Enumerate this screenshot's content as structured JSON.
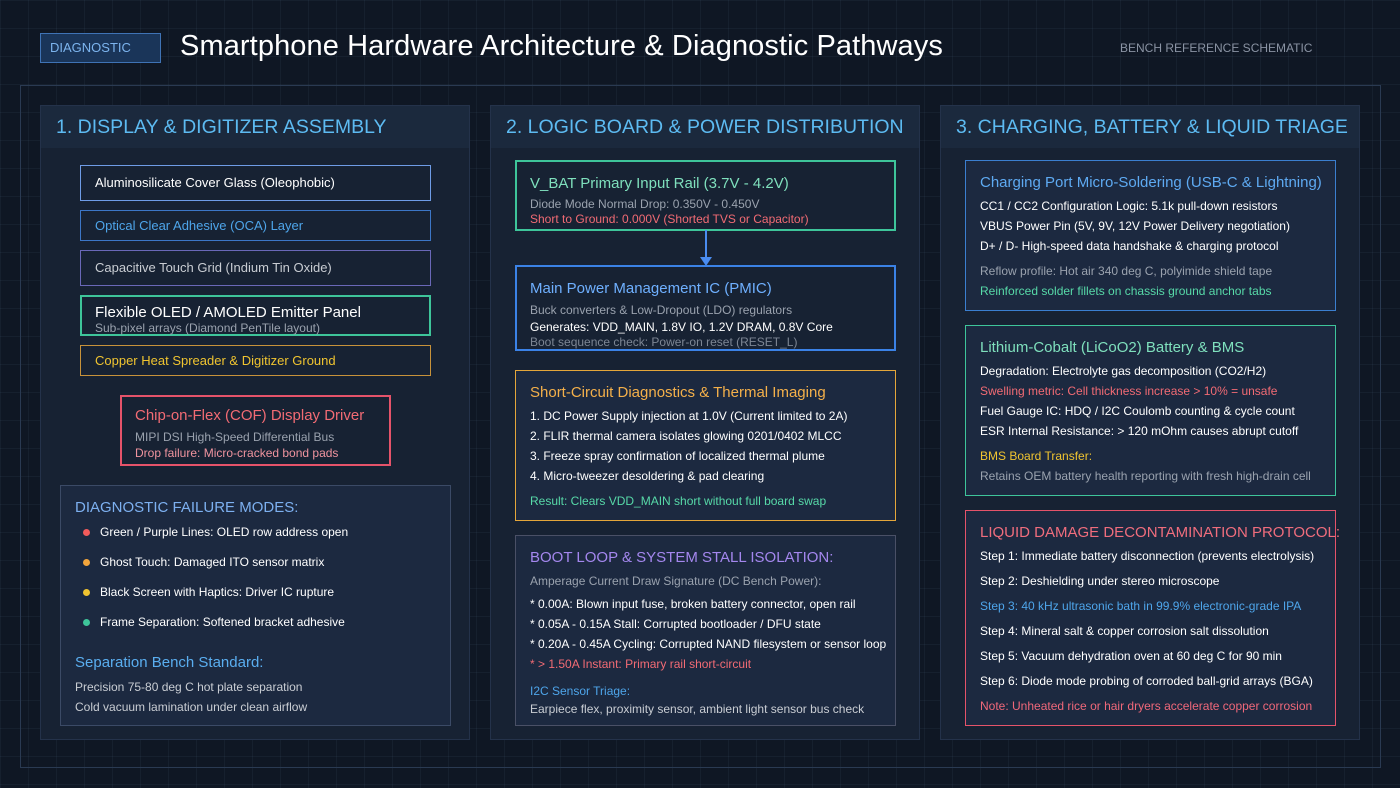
{
  "header": {
    "badge": "DIAGNOSTIC",
    "title": "Smartphone Hardware Architecture & Diagnostic Pathways",
    "reference": "BENCH REFERENCE SCHEMATIC"
  },
  "col1": {
    "title": "1. DISPLAY & DIGITIZER ASSEMBLY",
    "layers": [
      "Aluminosilicate Cover Glass (Oleophobic)",
      "Optical Clear Adhesive (OCA) Layer",
      "Capacitive Touch Grid (Indium Tin Oxide)",
      "Flexible OLED / AMOLED Emitter Panel",
      "Copper Heat Spreader & Digitizer Ground"
    ],
    "oled_sub": "Sub-pixel arrays (Diamond PenTile layout)",
    "cof": {
      "title": "Chip-on-Flex (COF) Display Driver",
      "line1": "MIPI DSI High-Speed Differential Bus",
      "line2": "Drop failure: Micro-cracked bond pads"
    },
    "failure": {
      "title": "DIAGNOSTIC FAILURE MODES:",
      "items": [
        "Green / Purple Lines: OLED row address open",
        "Ghost Touch: Damaged ITO sensor matrix",
        "Black Screen with Haptics: Driver IC rupture",
        "Frame Separation: Softened bracket adhesive"
      ],
      "dot_colors": [
        "#f25b5b",
        "#f3a53c",
        "#f0c330",
        "#3ec59a"
      ],
      "standard_title": "Separation Bench Standard:",
      "standard_lines": [
        "Precision 75-80 deg C hot plate separation",
        "Cold vacuum lamination under clean airflow"
      ]
    }
  },
  "col2": {
    "title": "2. LOGIC BOARD & POWER DISTRIBUTION",
    "vbat": {
      "title": "V_BAT Primary Input Rail (3.7V - 4.2V)",
      "line1": "Diode Mode Normal Drop: 0.350V - 0.450V",
      "line2": "Short to Ground: 0.000V (Shorted TVS or Capacitor)"
    },
    "pmic": {
      "title": "Main Power Management IC (PMIC)",
      "line1": "Buck converters & Low-Dropout (LDO) regulators",
      "line2": "Generates: VDD_MAIN, 1.8V IO, 1.2V DRAM, 0.8V Core",
      "line3": "Boot sequence check: Power-on reset (RESET_L)"
    },
    "short": {
      "title": "Short-Circuit Diagnostics & Thermal Imaging",
      "steps": [
        "1. DC Power Supply injection at 1.0V (Current limited to 2A)",
        "2. FLIR thermal camera isolates glowing 0201/0402 MLCC",
        "3. Freeze spray confirmation of localized thermal plume",
        "4. Micro-tweezer desoldering & pad clearing"
      ],
      "result": "Result: Clears VDD_MAIN short without full board swap"
    },
    "boot": {
      "title": "BOOT LOOP & SYSTEM STALL ISOLATION:",
      "subtitle": "Amperage Current Draw Signature (DC Bench Power):",
      "lines": [
        "* 0.00A: Blown input fuse, broken battery connector, open rail",
        "* 0.05A - 0.15A Stall: Corrupted bootloader / DFU state",
        "* 0.20A - 0.45A Cycling: Corrupted NAND filesystem or sensor loop"
      ],
      "warning": "* > 1.50A Instant: Primary rail short-circuit",
      "i2c_title": "I2C Sensor Triage:",
      "i2c_line": "Earpiece flex, proximity sensor, ambient light sensor bus check"
    }
  },
  "col3": {
    "title": "3. CHARGING, BATTERY & LIQUID TRIAGE",
    "port": {
      "title": "Charging Port Micro-Soldering (USB-C & Lightning)",
      "lines": [
        "CC1 / CC2 Configuration Logic: 5.1k pull-down resistors",
        "VBUS Power Pin (5V, 9V, 12V Power Delivery negotiation)",
        "D+ / D- High-speed data handshake & charging protocol"
      ],
      "reflow": "Reflow profile: Hot air 340 deg C, polyimide shield tape",
      "reinforce": "Reinforced solder fillets on chassis ground anchor tabs"
    },
    "battery": {
      "title": "Lithium-Cobalt (LiCoO2) Battery & BMS",
      "line1": "Degradation: Electrolyte gas decomposition (CO2/H2)",
      "swelling": "Swelling metric: Cell thickness increase > 10% = unsafe",
      "line3": "Fuel Gauge IC: HDQ / I2C Coulomb counting & cycle count",
      "line4": "ESR Internal Resistance: > 120 mOhm causes abrupt cutoff",
      "bms_title": "BMS Board Transfer:",
      "bms_line": "Retains OEM battery health reporting with fresh high-drain cell"
    },
    "liquid": {
      "title": "LIQUID DAMAGE DECONTAMINATION PROTOCOL:",
      "steps": [
        "Step 1: Immediate battery disconnection (prevents electrolysis)",
        "Step 2: Deshielding under stereo microscope",
        "Step 3: 40 kHz ultrasonic bath in 99.9% electronic-grade IPA",
        "Step 4: Mineral salt & copper corrosion salt dissolution",
        "Step 5: Vacuum dehydration oven at 60 deg C for 90 min",
        "Step 6: Diode mode probing of corroded ball-grid arrays (BGA)"
      ],
      "note": "Note: Unheated rice or hair dryers accelerate copper corrosion"
    }
  },
  "colors": {
    "background": "#0f1724",
    "column_title": "#5dbbf2",
    "green": "#3ec59a",
    "blue": "#3b82e6",
    "orange": "#e4a63a",
    "red": "#e5536a",
    "purple": "#8f7ad6"
  }
}
